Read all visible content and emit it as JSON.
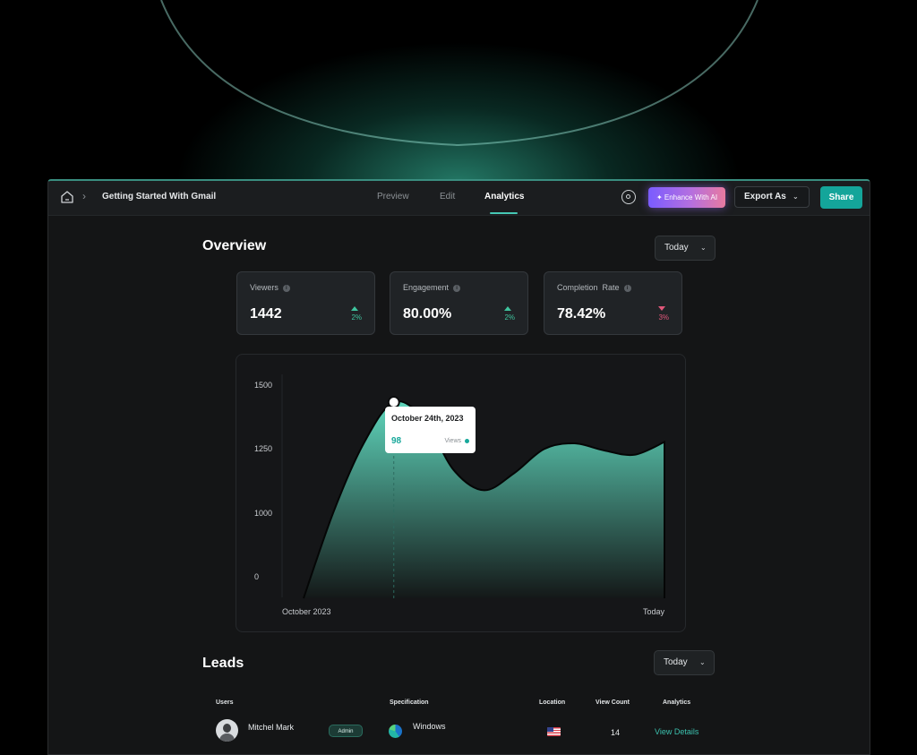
{
  "breadcrumb": {
    "title": "Getting Started With Gmail"
  },
  "tabs": [
    {
      "label": "Preview"
    },
    {
      "label": "Edit"
    },
    {
      "label": "Analytics"
    }
  ],
  "toolbar": {
    "enhance_label": "Enhance With AI",
    "export_label": "Export As",
    "share_label": "Share"
  },
  "overview": {
    "title": "Overview",
    "range": "Today",
    "stats": [
      {
        "label": "Viewers",
        "value": "1442",
        "change": "2%",
        "trend": "up"
      },
      {
        "label": "Engagement",
        "value": "80.00%",
        "change": "2%",
        "trend": "up"
      },
      {
        "label": "Completion  Rate",
        "value": "78.42%",
        "change": "3%",
        "trend": "down"
      }
    ]
  },
  "chart_data": {
    "type": "area",
    "yticks": [
      "1500",
      "1250",
      "1000",
      "0"
    ],
    "x_labels": [
      "October 2023",
      "Today"
    ],
    "series": [
      {
        "values": [
          0,
          610,
          1090,
          1380,
          1260,
          900,
          760,
          880,
          1050,
          1090,
          1040,
          1010,
          1100
        ]
      }
    ],
    "highlight_index": 3,
    "tooltip": {
      "date": "October 24th, 2023",
      "value": "98",
      "label": "Views"
    },
    "grid": false,
    "colors": {
      "fill_top": "#5fd6bc",
      "fill_bottom": "#141818",
      "line": "#050606"
    }
  },
  "leads": {
    "title": "Leads",
    "range": "Today",
    "columns": [
      "Users",
      "Specification",
      "Location",
      "View Count",
      "Analytics"
    ],
    "rows": [
      {
        "user": "Mitchel Mark",
        "role": "Admin",
        "spec": "Windows",
        "location": "United States",
        "views": "14",
        "action": "View Details"
      }
    ]
  }
}
